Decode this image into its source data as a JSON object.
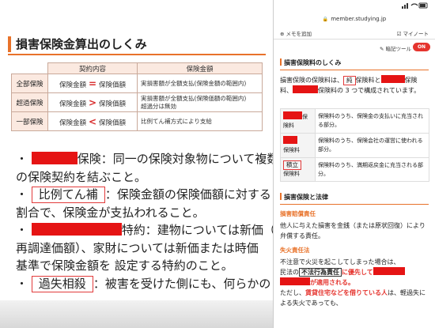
{
  "slide": {
    "title": "損害保険金算出のしくみ",
    "table": {
      "headers": [
        "契約内容",
        "保険金額"
      ],
      "rows": [
        {
          "label": "全部保険",
          "left": "保険金額",
          "op": "=",
          "right": "保険価額",
          "result": "実損害額が全額支払(保険金額の範囲内)"
        },
        {
          "label": "超過保険",
          "left": "保険金額",
          "op": ">",
          "right": "保険価額",
          "result": "実損害額が全額支払(保険価額の範囲内)",
          "result2": "超過分は無効"
        },
        {
          "label": "一部保険",
          "left": "保険金額",
          "op": "<",
          "right": "保険価額",
          "result": "比例てん補方式により支給"
        }
      ]
    },
    "notes": {
      "bullet": "・",
      "line1_after": "保険：同一の保険対象物について複数",
      "line2": "の保険契約を結ぶこと。",
      "line3_box": "比例てん補",
      "line3_after": "：保険金額の保険価額に対する",
      "line4": "割合で、保険金が支払われること。",
      "line5_after": "特約：建物については新価（",
      "line6": "再調達価額）、家財については新価または時価",
      "line7": "基準で保険金額を 設定する特約のこと。",
      "line8_box": "過失相殺",
      "line8_after": "：被害を受けた側にも、何らかの"
    }
  },
  "browser": {
    "url": "member.studying.jp",
    "memo_button": "メモを追加",
    "mynote_button": "マイノート",
    "marker_tool_label": "暗記ツール",
    "marker_toggle": "ON"
  },
  "right_panel": {
    "section1_title": "損害保険料のしくみ",
    "para1_a": "損害保険の保険料は、",
    "para1_box": "純",
    "para1_b": "保険料と",
    "para1_c": "保",
    "para1_d": "険料、",
    "para1_e": "保険料の 3 つで構成されています。",
    "table": [
      {
        "head_suffix": "保",
        "head2": "険料",
        "body": "保険料のうち、保険金の支払いに充当される部分。"
      },
      {
        "head_suffix": "",
        "head2": "保険料",
        "body": "保険料のうち、保険会社の運営に使われる部分。"
      },
      {
        "head_box": "積立",
        "head2": "保険料",
        "body": "保険料のうち、満期返戻金に充当される部分。"
      }
    ],
    "section2_title": "損害保険と法律",
    "sub1_title": "損害賠償責任",
    "sub1_text": "他人に与えた損害を金銭（または原状回復）により弁償する責任。",
    "sub2_title": "失火責任法",
    "sub2_text1": "不注意で火災を起こしてしまった場合は、",
    "sub2_text2": "民法の",
    "sub2_box": "不法行為責任",
    "sub2_text3": "に優先して",
    "sub2_text4": "が適用される。",
    "sub2_text5_a": "ただし、",
    "sub2_text5_b": "賃貸住宅などを借りている人",
    "sub2_text5_c": "は、軽過失による失火であっても、"
  },
  "colors": {
    "accent": "#e8722a",
    "mask_red": "#e51414",
    "box_red": "#e23b3b"
  }
}
